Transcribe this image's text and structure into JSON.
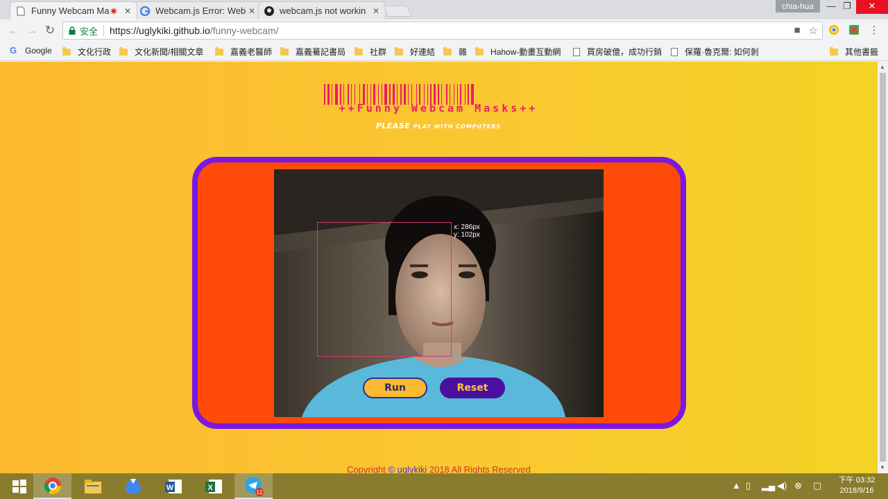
{
  "browser": {
    "tabs": [
      {
        "title": "Funny Webcam Ma",
        "recording": true,
        "active": true
      },
      {
        "title": "Webcam.js Error: Web",
        "active": false
      },
      {
        "title": "webcam.js not workin",
        "active": false
      }
    ],
    "profile": "chia-hua",
    "address": {
      "secure_label": "安全",
      "host": "https://uglykiki.github.io",
      "path": "/funny-webcam/"
    },
    "bookmarks": [
      "Google",
      "文化行政",
      "文化新聞/相關文章",
      "嘉義老醫師",
      "嘉義驀記書局",
      "社群",
      "好連結",
      "雜",
      "Hahow-動畫互動網",
      "買房破億，成功行銷",
      "保羅·魯克爾: 如何剝",
      "其他書籤"
    ]
  },
  "page": {
    "logo_text": "++Funny Webcam Masks++",
    "tagline_big": "PLEASE",
    "tagline_small": "PLAY WITH COMPUTERS",
    "detect_x": "x: 286px",
    "detect_y": "y: 102px",
    "run_label": "Run",
    "reset_label": "Reset",
    "copyright_prefix": "Copyright",
    "copyright_link": "© uglykiki",
    "copyright_suffix": "2018 All Rights Reserved"
  },
  "taskbar": {
    "telegram_badge": "12",
    "time": "下午 03:32",
    "date": "2018/9/16"
  },
  "colors": {
    "accent": "#7a17e3",
    "stage": "#ff4a0a",
    "page_bg": "#fdb92f",
    "logo": "#e91e63"
  }
}
